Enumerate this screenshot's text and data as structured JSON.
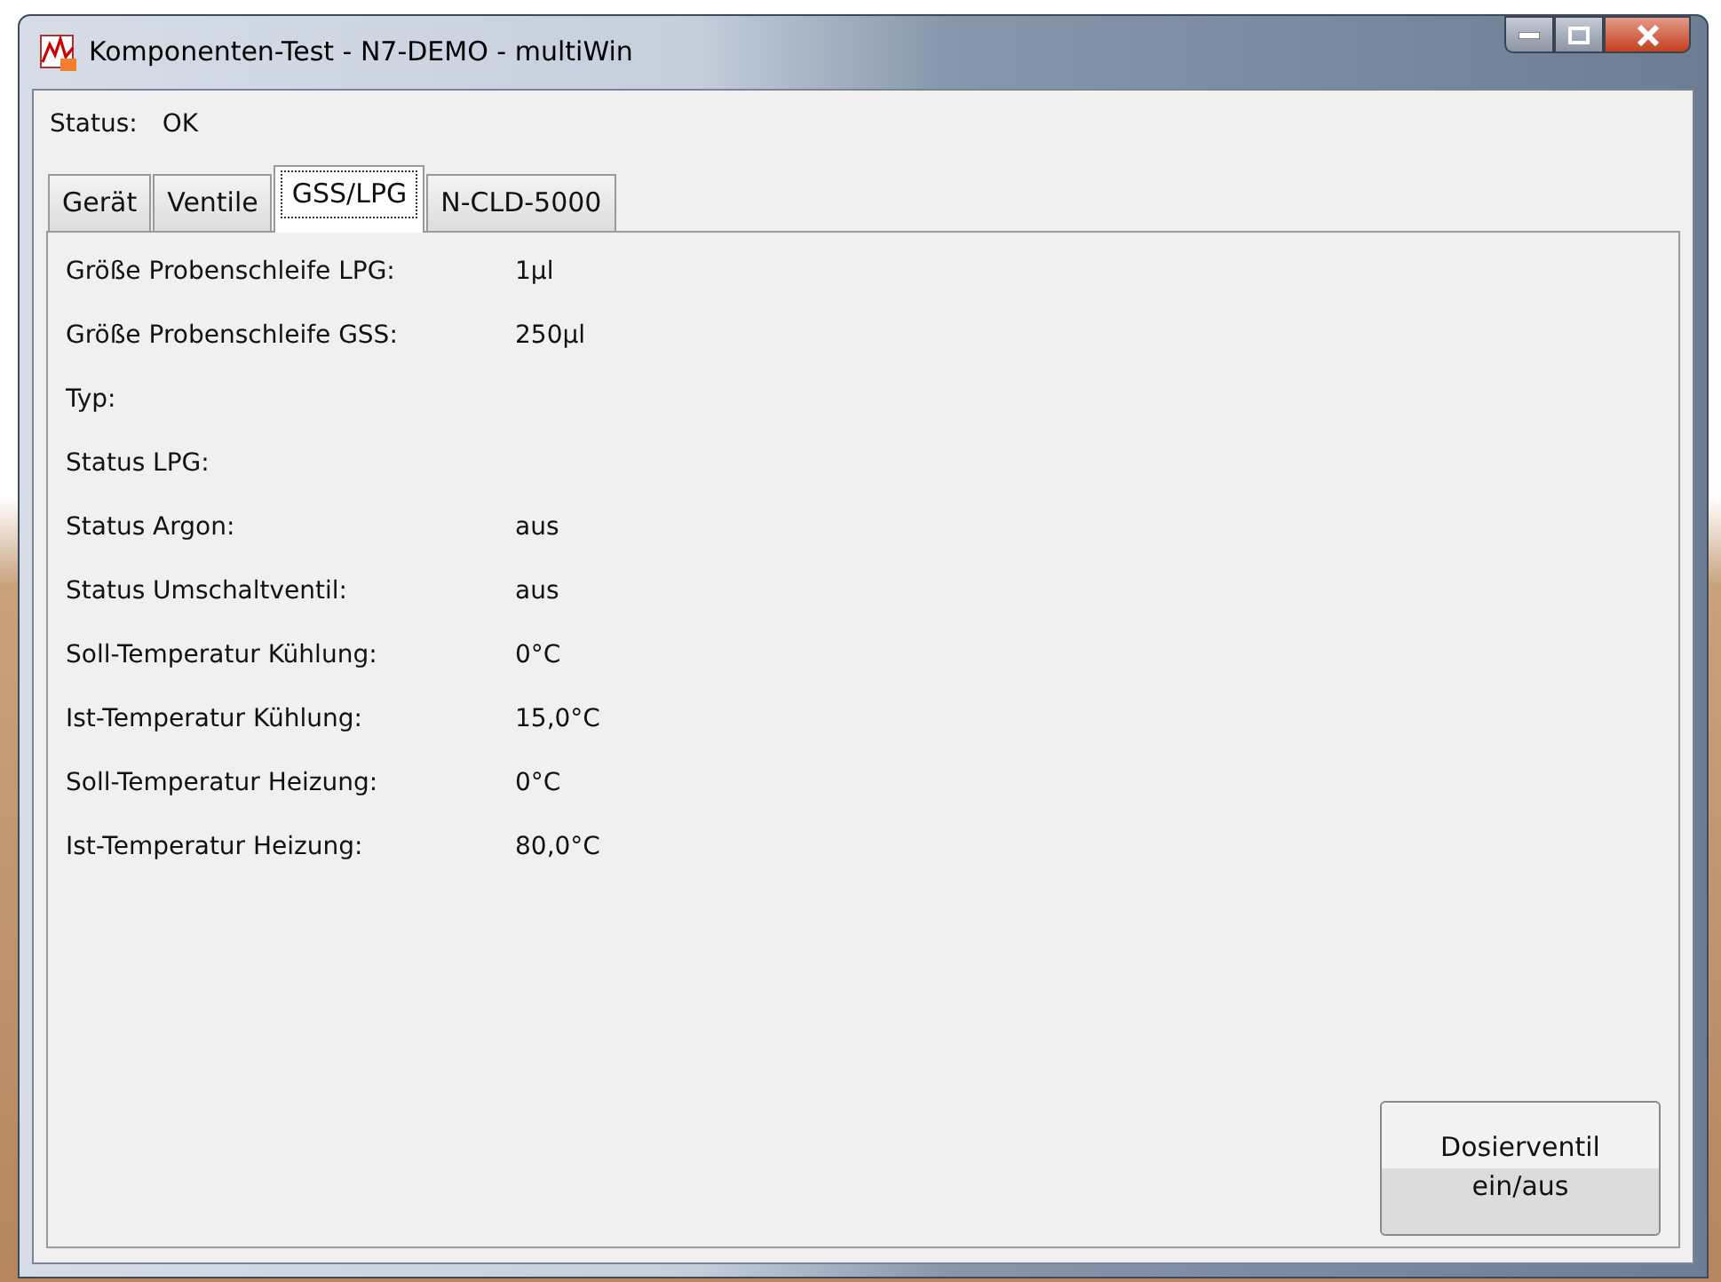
{
  "window": {
    "title": "Komponenten-Test - N7-DEMO - multiWin"
  },
  "status": {
    "label": "Status:",
    "value": "OK"
  },
  "tabs": [
    {
      "label": "Gerät",
      "selected": false
    },
    {
      "label": "Ventile",
      "selected": false
    },
    {
      "label": "GSS/LPG",
      "selected": true
    },
    {
      "label": "N-CLD-5000",
      "selected": false
    }
  ],
  "fields": [
    {
      "label": "Größe Probenschleife LPG:",
      "value": "1µl"
    },
    {
      "label": "Größe Probenschleife GSS:",
      "value": "250µl"
    },
    {
      "label": "Typ:"
    },
    {
      "label": "Status LPG:"
    },
    {
      "label": "Status Argon:",
      "value": "aus"
    },
    {
      "label": "Status Umschaltventil:",
      "value": "aus"
    },
    {
      "label": "Soll-Temperatur Kühlung:",
      "value": "0°C"
    },
    {
      "label": "Ist-Temperatur Kühlung:",
      "value": "15,0°C"
    },
    {
      "label": "Soll-Temperatur Heizung:",
      "value": "0°C"
    },
    {
      "label": "Ist-Temperatur Heizung:",
      "value": "80,0°C"
    }
  ],
  "button": {
    "label": "Dosierventil ein/aus"
  }
}
